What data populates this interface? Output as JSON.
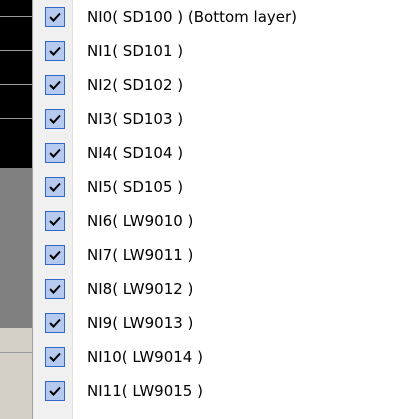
{
  "menu": {
    "items": [
      {
        "label": "NI0( SD100 ) (Bottom layer)",
        "checked": true
      },
      {
        "label": "NI1( SD101 )",
        "checked": true
      },
      {
        "label": "NI2( SD102 )",
        "checked": true
      },
      {
        "label": "NI3( SD103 )",
        "checked": true
      },
      {
        "label": "NI4( SD104 )",
        "checked": true
      },
      {
        "label": "NI5( SD105 )",
        "checked": true
      },
      {
        "label": "NI6( LW9010 )",
        "checked": true
      },
      {
        "label": "NI7( LW9011 )",
        "checked": true
      },
      {
        "label": "NI8( LW9012 )",
        "checked": true
      },
      {
        "label": "NI9( LW9013 )",
        "checked": true
      },
      {
        "label": "NI10( LW9014 )",
        "checked": true
      },
      {
        "label": "NI11( LW9015 )",
        "checked": true
      }
    ],
    "check_icon": "checkmark-icon",
    "colors": {
      "check_fill": "#b6c9ee",
      "check_border": "#316ac5",
      "gutter": "#f0f0f0",
      "menu_bg": "#ffffff"
    }
  }
}
